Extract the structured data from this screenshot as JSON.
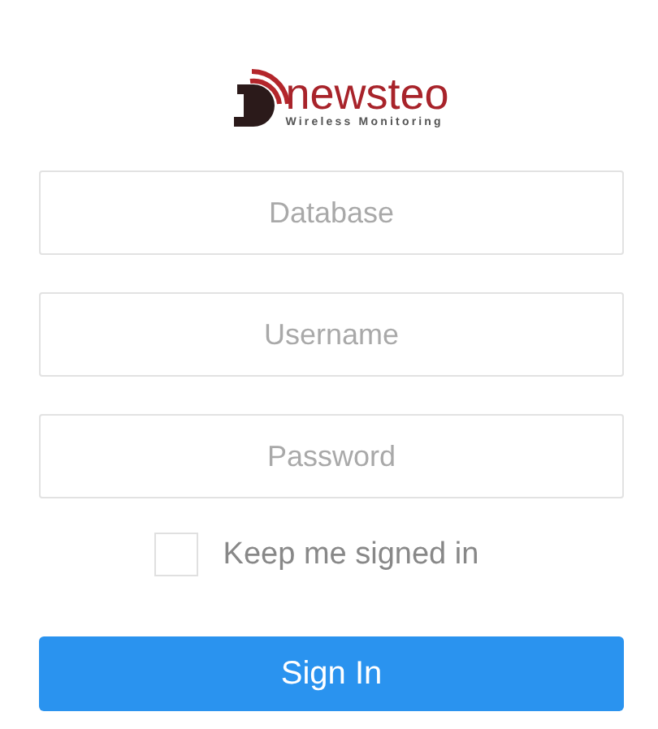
{
  "logo": {
    "name": "newsteo",
    "tagline": "Wireless Monitoring"
  },
  "fields": [
    {
      "placeholder": "Database"
    },
    {
      "placeholder": "Username"
    },
    {
      "placeholder": "Password"
    }
  ],
  "remember": {
    "label": "Keep me signed in",
    "checked": false
  },
  "submit": {
    "label": "Sign In"
  }
}
